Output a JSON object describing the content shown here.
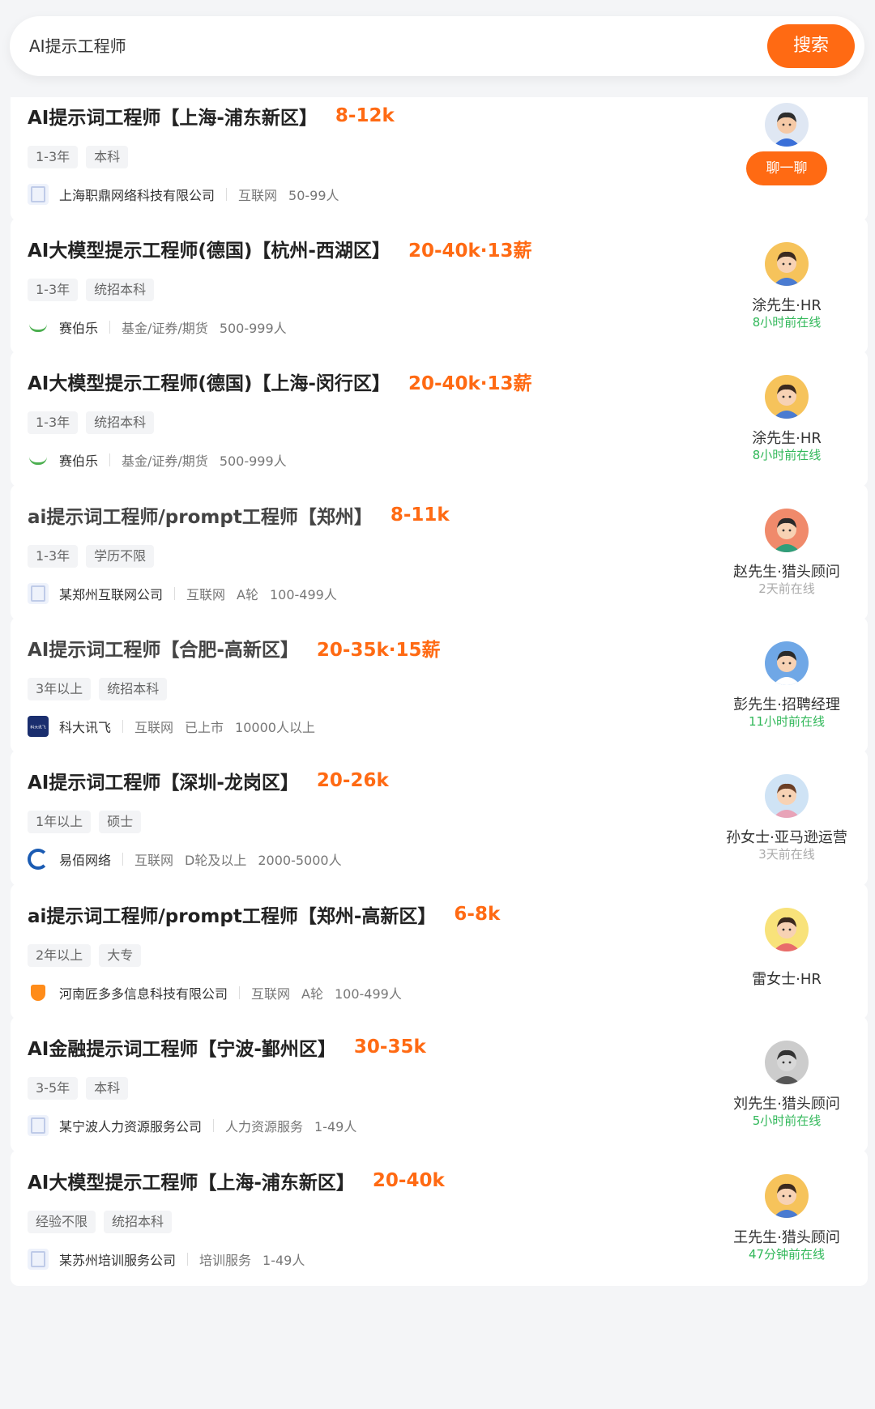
{
  "search": {
    "query": "AI提示工程师",
    "button_label": "搜索"
  },
  "jobs": [
    {
      "title": "AI提示词工程师【上海-浦东新区】",
      "salary": "8-12k",
      "tags": [
        "1-3年",
        "本科"
      ],
      "company": "上海职鼎网络科技有限公司",
      "meta": [
        "互联网",
        "50-99人"
      ],
      "logo": "generic",
      "hr_name": "",
      "hr_status": "",
      "chat_label": "聊一聊"
    },
    {
      "title": "AI大模型提示工程师(德国)【杭州-西湖区】",
      "salary": "20-40k·13薪",
      "tags": [
        "1-3年",
        "统招本科"
      ],
      "company": "赛伯乐",
      "meta": [
        "基金/证券/期货",
        "500-999人"
      ],
      "logo": "green",
      "hr_name": "涂先生·HR",
      "hr_status": "8小时前在线"
    },
    {
      "title": "AI大模型提示工程师(德国)【上海-闵行区】",
      "salary": "20-40k·13薪",
      "tags": [
        "1-3年",
        "统招本科"
      ],
      "company": "赛伯乐",
      "meta": [
        "基金/证券/期货",
        "500-999人"
      ],
      "logo": "green",
      "hr_name": "涂先生·HR",
      "hr_status": "8小时前在线"
    },
    {
      "title": "ai提示词工程师/prompt工程师【郑州】",
      "salary": "8-11k",
      "tags": [
        "1-3年",
        "学历不限"
      ],
      "company": "某郑州互联网公司",
      "meta": [
        "互联网",
        "A轮",
        "100-499人"
      ],
      "logo": "generic",
      "hr_name": "赵先生·猎头顾问",
      "hr_status": "2天前在线"
    },
    {
      "title": "AI提示词工程师【合肥-高新区】",
      "salary": "20-35k·15薪",
      "tags": [
        "3年以上",
        "统招本科"
      ],
      "company": "科大讯飞",
      "meta": [
        "互联网",
        "已上市",
        "10000人以上"
      ],
      "logo": "iflytek",
      "hr_name": "彭先生·招聘经理",
      "hr_status": "11小时前在线"
    },
    {
      "title": "AI提示词工程师【深圳-龙岗区】",
      "salary": "20-26k",
      "tags": [
        "1年以上",
        "硕士"
      ],
      "company": "易佰网络",
      "meta": [
        "互联网",
        "D轮及以上",
        "2000-5000人"
      ],
      "logo": "yibai",
      "hr_name": "孙女士·亚马逊运营",
      "hr_status": "3天前在线"
    },
    {
      "title": "ai提示词工程师/prompt工程师【郑州-高新区】",
      "salary": "6-8k",
      "tags": [
        "2年以上",
        "大专"
      ],
      "company": "河南匠多多信息科技有限公司",
      "meta": [
        "互联网",
        "A轮",
        "100-499人"
      ],
      "logo": "orange",
      "hr_name": "雷女士·HR",
      "hr_status": ""
    },
    {
      "title": "AI金融提示词工程师【宁波-鄞州区】",
      "salary": "30-35k",
      "tags": [
        "3-5年",
        "本科"
      ],
      "company": "某宁波人力资源服务公司",
      "meta": [
        "人力资源服务",
        "1-49人"
      ],
      "logo": "generic",
      "hr_name": "刘先生·猎头顾问",
      "hr_status": "5小时前在线"
    },
    {
      "title": "AI大模型提示工程师【上海-浦东新区】",
      "salary": "20-40k",
      "tags": [
        "经验不限",
        "统招本科"
      ],
      "company": "某苏州培训服务公司",
      "meta": [
        "培训服务",
        "1-49人"
      ],
      "logo": "generic",
      "hr_name": "王先生·猎头顾问",
      "hr_status": "47分钟前在线"
    }
  ],
  "logo_texts": {
    "iflytek": "科大讯飞"
  },
  "status_colors": {
    "online": "#32b85a",
    "offline": "#aaaaaa"
  },
  "accent_color": "#ff6a13"
}
